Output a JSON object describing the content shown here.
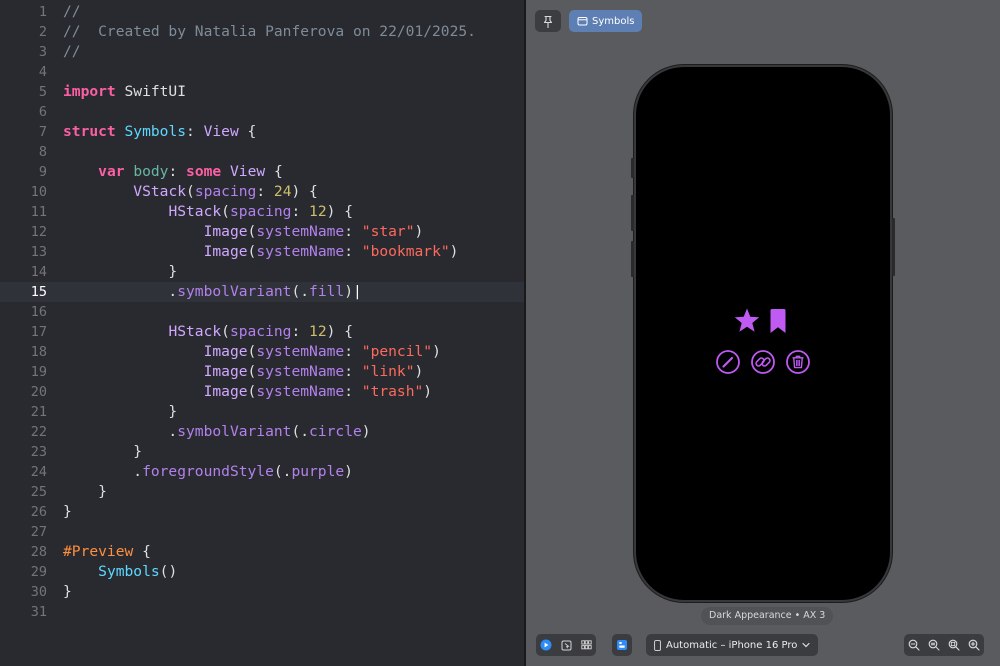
{
  "editor": {
    "current_line": 15,
    "lines": [
      {
        "n": "1",
        "tokens": [
          {
            "t": "//",
            "c": "comment"
          }
        ]
      },
      {
        "n": "2",
        "tokens": [
          {
            "t": "//  Created by Natalia Panferova on 22/01/2025.",
            "c": "comment"
          }
        ]
      },
      {
        "n": "3",
        "tokens": [
          {
            "t": "//",
            "c": "comment"
          }
        ]
      },
      {
        "n": "4",
        "tokens": []
      },
      {
        "n": "5",
        "tokens": [
          {
            "t": "import",
            "c": "kw"
          },
          {
            "t": " SwiftUI",
            "c": "plain"
          }
        ]
      },
      {
        "n": "6",
        "tokens": []
      },
      {
        "n": "7",
        "tokens": [
          {
            "t": "struct",
            "c": "kw"
          },
          {
            "t": " ",
            "c": "plain"
          },
          {
            "t": "Symbols",
            "c": "type"
          },
          {
            "t": ": ",
            "c": "plain"
          },
          {
            "t": "View",
            "c": "typeu"
          },
          {
            "t": " {",
            "c": "plain"
          }
        ]
      },
      {
        "n": "8",
        "tokens": []
      },
      {
        "n": "9",
        "tokens": [
          {
            "t": "    ",
            "c": "plain"
          },
          {
            "t": "var",
            "c": "kw"
          },
          {
            "t": " ",
            "c": "plain"
          },
          {
            "t": "body",
            "c": "prop"
          },
          {
            "t": ": ",
            "c": "plain"
          },
          {
            "t": "some",
            "c": "kw"
          },
          {
            "t": " ",
            "c": "plain"
          },
          {
            "t": "View",
            "c": "typeu"
          },
          {
            "t": " {",
            "c": "plain"
          }
        ]
      },
      {
        "n": "10",
        "tokens": [
          {
            "t": "        ",
            "c": "plain"
          },
          {
            "t": "VStack",
            "c": "typeu"
          },
          {
            "t": "(",
            "c": "plain"
          },
          {
            "t": "spacing",
            "c": "param"
          },
          {
            "t": ": ",
            "c": "plain"
          },
          {
            "t": "24",
            "c": "num"
          },
          {
            "t": ") {",
            "c": "plain"
          }
        ]
      },
      {
        "n": "11",
        "tokens": [
          {
            "t": "            ",
            "c": "plain"
          },
          {
            "t": "HStack",
            "c": "typeu"
          },
          {
            "t": "(",
            "c": "plain"
          },
          {
            "t": "spacing",
            "c": "param"
          },
          {
            "t": ": ",
            "c": "plain"
          },
          {
            "t": "12",
            "c": "num"
          },
          {
            "t": ") {",
            "c": "plain"
          }
        ]
      },
      {
        "n": "12",
        "tokens": [
          {
            "t": "                ",
            "c": "plain"
          },
          {
            "t": "Image",
            "c": "typeu"
          },
          {
            "t": "(",
            "c": "plain"
          },
          {
            "t": "systemName",
            "c": "param"
          },
          {
            "t": ": ",
            "c": "plain"
          },
          {
            "t": "\"star\"",
            "c": "str"
          },
          {
            "t": ")",
            "c": "plain"
          }
        ]
      },
      {
        "n": "13",
        "tokens": [
          {
            "t": "                ",
            "c": "plain"
          },
          {
            "t": "Image",
            "c": "typeu"
          },
          {
            "t": "(",
            "c": "plain"
          },
          {
            "t": "systemName",
            "c": "param"
          },
          {
            "t": ": ",
            "c": "plain"
          },
          {
            "t": "\"bookmark\"",
            "c": "str"
          },
          {
            "t": ")",
            "c": "plain"
          }
        ]
      },
      {
        "n": "14",
        "tokens": [
          {
            "t": "            }",
            "c": "plain"
          }
        ]
      },
      {
        "n": "15",
        "tokens": [
          {
            "t": "            .",
            "c": "plain"
          },
          {
            "t": "symbolVariant",
            "c": "method"
          },
          {
            "t": "(.",
            "c": "plain"
          },
          {
            "t": "fill",
            "c": "method"
          },
          {
            "t": ")",
            "c": "plain"
          },
          {
            "t": "|",
            "c": "caret"
          }
        ]
      },
      {
        "n": "16",
        "tokens": []
      },
      {
        "n": "17",
        "tokens": [
          {
            "t": "            ",
            "c": "plain"
          },
          {
            "t": "HStack",
            "c": "typeu"
          },
          {
            "t": "(",
            "c": "plain"
          },
          {
            "t": "spacing",
            "c": "param"
          },
          {
            "t": ": ",
            "c": "plain"
          },
          {
            "t": "12",
            "c": "num"
          },
          {
            "t": ") {",
            "c": "plain"
          }
        ]
      },
      {
        "n": "18",
        "tokens": [
          {
            "t": "                ",
            "c": "plain"
          },
          {
            "t": "Image",
            "c": "typeu"
          },
          {
            "t": "(",
            "c": "plain"
          },
          {
            "t": "systemName",
            "c": "param"
          },
          {
            "t": ": ",
            "c": "plain"
          },
          {
            "t": "\"pencil\"",
            "c": "str"
          },
          {
            "t": ")",
            "c": "plain"
          }
        ]
      },
      {
        "n": "19",
        "tokens": [
          {
            "t": "                ",
            "c": "plain"
          },
          {
            "t": "Image",
            "c": "typeu"
          },
          {
            "t": "(",
            "c": "plain"
          },
          {
            "t": "systemName",
            "c": "param"
          },
          {
            "t": ": ",
            "c": "plain"
          },
          {
            "t": "\"link\"",
            "c": "str"
          },
          {
            "t": ")",
            "c": "plain"
          }
        ]
      },
      {
        "n": "20",
        "tokens": [
          {
            "t": "                ",
            "c": "plain"
          },
          {
            "t": "Image",
            "c": "typeu"
          },
          {
            "t": "(",
            "c": "plain"
          },
          {
            "t": "systemName",
            "c": "param"
          },
          {
            "t": ": ",
            "c": "plain"
          },
          {
            "t": "\"trash\"",
            "c": "str"
          },
          {
            "t": ")",
            "c": "plain"
          }
        ]
      },
      {
        "n": "21",
        "tokens": [
          {
            "t": "            }",
            "c": "plain"
          }
        ]
      },
      {
        "n": "22",
        "tokens": [
          {
            "t": "            .",
            "c": "plain"
          },
          {
            "t": "symbolVariant",
            "c": "method"
          },
          {
            "t": "(.",
            "c": "plain"
          },
          {
            "t": "circle",
            "c": "method"
          },
          {
            "t": ")",
            "c": "plain"
          }
        ]
      },
      {
        "n": "23",
        "tokens": [
          {
            "t": "        }",
            "c": "plain"
          }
        ]
      },
      {
        "n": "24",
        "tokens": [
          {
            "t": "        .",
            "c": "plain"
          },
          {
            "t": "foregroundStyle",
            "c": "method"
          },
          {
            "t": "(.",
            "c": "plain"
          },
          {
            "t": "purple",
            "c": "method"
          },
          {
            "t": ")",
            "c": "plain"
          }
        ]
      },
      {
        "n": "25",
        "tokens": [
          {
            "t": "    }",
            "c": "plain"
          }
        ]
      },
      {
        "n": "26",
        "tokens": [
          {
            "t": "}",
            "c": "plain"
          }
        ]
      },
      {
        "n": "27",
        "tokens": []
      },
      {
        "n": "28",
        "tokens": [
          {
            "t": "#Preview",
            "c": "macro"
          },
          {
            "t": " {",
            "c": "plain"
          }
        ]
      },
      {
        "n": "29",
        "tokens": [
          {
            "t": "    ",
            "c": "plain"
          },
          {
            "t": "Symbols",
            "c": "type"
          },
          {
            "t": "()",
            "c": "plain"
          }
        ]
      },
      {
        "n": "30",
        "tokens": [
          {
            "t": "}",
            "c": "plain"
          }
        ]
      },
      {
        "n": "31",
        "tokens": []
      }
    ]
  },
  "preview": {
    "pin_icon": "pin-icon",
    "tab_label": "Symbols",
    "tab_icon": "preview-window-icon",
    "appearance_label": "Dark Appearance • AX 3",
    "device_label": "Automatic – iPhone 16 Pro",
    "symbol_color": "#bf5af2",
    "symbols_row1": [
      "star-fill-icon",
      "bookmark-fill-icon"
    ],
    "symbols_row2": [
      "pencil-circle-icon",
      "link-circle-icon",
      "trash-circle-icon"
    ],
    "toolbar_left": [
      "live-play-icon",
      "selectable-icon",
      "variants-grid-icon"
    ],
    "toolbar_zoom": [
      "zoom-out-icon",
      "zoom-actual-icon",
      "zoom-fit-icon",
      "zoom-in-icon"
    ]
  }
}
